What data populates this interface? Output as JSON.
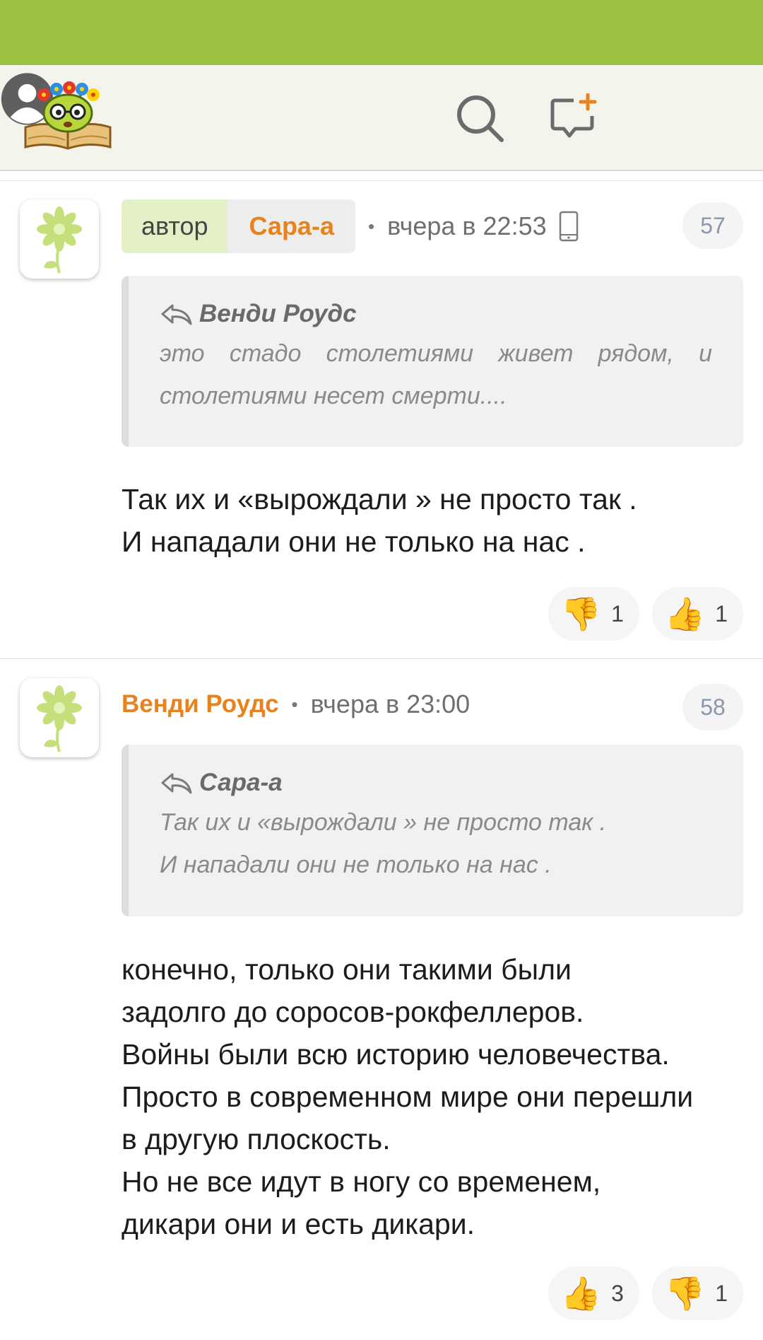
{
  "icons": {
    "search": "search-icon",
    "new_post": "new-post-icon",
    "profile": "user-avatar-icon",
    "chevron": "chevron-down-icon",
    "reply": "reply-arrow-icon",
    "device": "mobile-phone-icon",
    "dislike": "thumbs-down-icon",
    "like": "thumbs-up-icon"
  },
  "colors": {
    "status_bar": "#9bc143",
    "accent_name": "#e8821c",
    "author_chip": "#e3f0c6"
  },
  "comments": [
    {
      "author_label": "автор",
      "author": "Сара-а",
      "dot": "•",
      "time": "вчера в 22:53",
      "number": "57",
      "quote_author": "Венди Роудс",
      "quote_text": "это стадо столетиями живет рядом, и столетиями несет смерти....",
      "text": "Так их и «вырождали » не просто так .\nИ нападали они не только на нас .",
      "reactions": [
        {
          "emoji": "👎",
          "count": "1"
        },
        {
          "emoji": "👍",
          "count": "1"
        }
      ]
    },
    {
      "author": "Венди Роудс",
      "dot": "•",
      "time": "вчера в 23:00",
      "number": "58",
      "quote_author": "Сара-а",
      "quote_line1": "Так их и «вырождали » не просто так .",
      "quote_line2": "И нападали они не только на нас .",
      "text": "конечно, только они такими были\nзадолго до соросов-рокфеллеров.\nВойны были всю историю человечества.\nПросто в современном мире они перешли\nв другую плоскость.\nНо не все идут в ногу со временем,\nдикари они и есть дикари.",
      "reactions": [
        {
          "emoji": "👍",
          "count": "3"
        },
        {
          "emoji": "👎",
          "count": "1"
        }
      ]
    }
  ]
}
